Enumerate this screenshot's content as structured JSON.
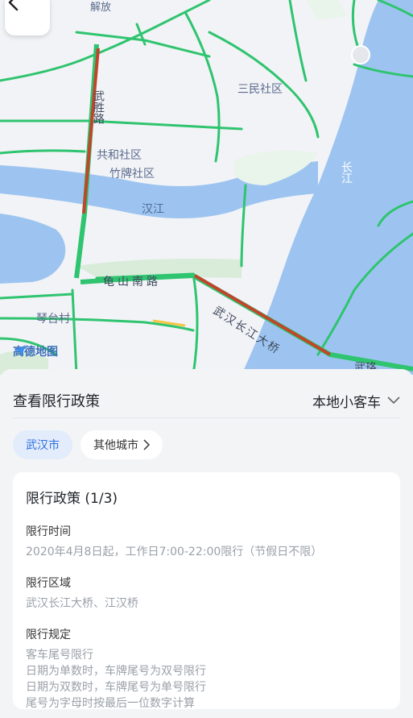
{
  "map": {
    "labels": {
      "sanmin": "三民社区",
      "gonghe": "共和社区",
      "zhupai": "竹牌社区",
      "hanjiang": "汉江",
      "changjiang": "长江",
      "qintai": "琴台村",
      "jiefang": "解放",
      "wusheng": "武胜路",
      "guishan": "龟山南路",
      "bridge": "武汉长江大桥",
      "wuluo": "武珞"
    },
    "logo_text": "高德地图",
    "colors": {
      "water": "#9dc4f0",
      "road_green": "#2fc46f",
      "congestion": "#c0452b",
      "park": "#d8ecd9"
    }
  },
  "nav": {
    "back_icon": "chevron-left-icon"
  },
  "sheet": {
    "title": "查看限行政策",
    "vehicle_type": "本地小客车",
    "chips": {
      "current": "武汉市",
      "other": "其他城市"
    },
    "card": {
      "title": "限行政策 (1/3)",
      "time_label": "限行时间",
      "time_value": "2020年4月8日起，工作日7:00-22:00限行（节假日不限）",
      "area_label": "限行区域",
      "area_value": "武汉长江大桥、江汉桥",
      "rule_label": "限行规定",
      "rules": [
        "客车尾号限行",
        "日期为单数时，车牌尾号为双号限行",
        "日期为双数时，车牌尾号为单号限行",
        "尾号为字母时按最后一位数字计算"
      ]
    }
  }
}
